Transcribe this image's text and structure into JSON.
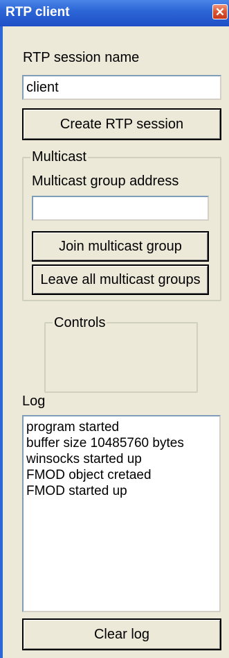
{
  "window": {
    "title": "RTP client",
    "close_icon": "close-icon"
  },
  "session": {
    "label": "RTP session name",
    "value": "client",
    "create_button": "Create RTP session",
    "create_mnemonic": "C"
  },
  "multicast": {
    "group_title": "Multicast",
    "address_label": "Multicast group address",
    "address_value": "",
    "join_button": "Join multicast group",
    "leave_button": "Leave all multicast groups"
  },
  "controls": {
    "group_title": "Controls"
  },
  "log": {
    "label": "Log",
    "lines": [
      "program started",
      "buffer size 10485760 bytes",
      "winsocks started up",
      "FMOD object cretaed",
      "FMOD started up"
    ],
    "clear_button": "Clear log"
  }
}
